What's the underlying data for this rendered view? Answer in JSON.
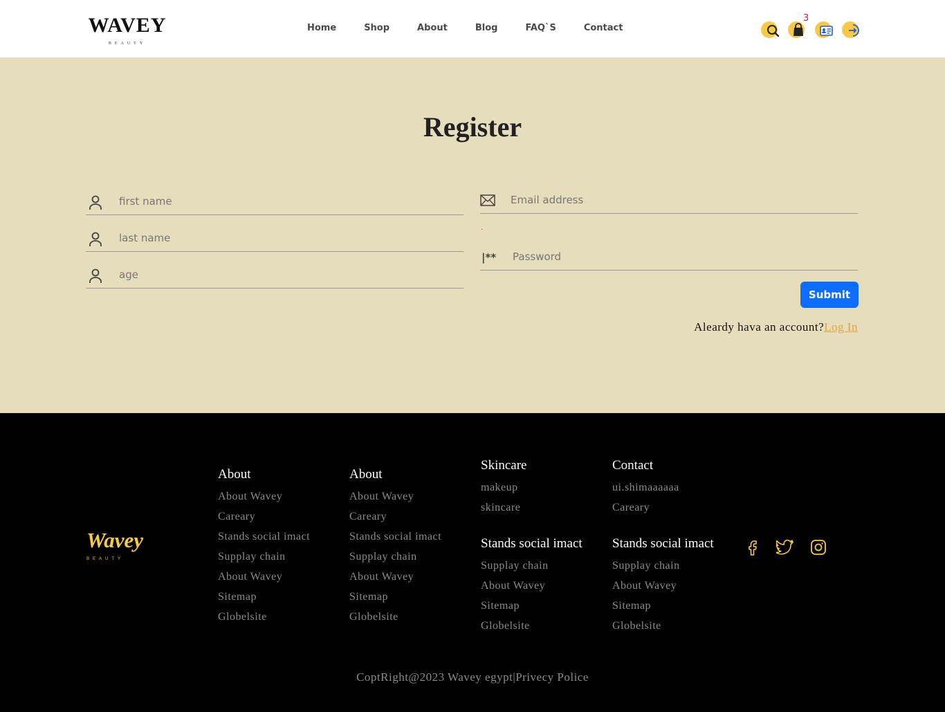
{
  "header": {
    "logo_main": "WAVEY",
    "logo_sub": "BEAUTY",
    "nav": [
      "Home",
      "Shop",
      "About",
      "Blog",
      "FAQ`S",
      "Contact"
    ],
    "cart_count": "3",
    "icons": [
      "search-icon",
      "cart-icon",
      "profile-card-icon",
      "login-icon"
    ],
    "icon_accent": "#f6c949"
  },
  "register": {
    "title": "Register",
    "first_name_placeholder": "first name",
    "last_name_placeholder": "last name",
    "age_placeholder": "age",
    "email_placeholder": "Email address",
    "email_error": ".",
    "password_mark": "|**",
    "password_placeholder": "Password",
    "submit_label": "Submit",
    "already_text": "Aleardy hava an account?",
    "login_link": "Log In",
    "background": "#e5ddbb",
    "submit_color": "#0d6efd"
  },
  "footer": {
    "logo_main": "Wavey",
    "logo_sub": "BEAUTY",
    "col1": {
      "title": "About",
      "links": [
        "About Wavey",
        "Careary",
        "Stands social imact",
        "Supplay chain",
        "About Wavey",
        "Sitemap",
        "Globelsite"
      ]
    },
    "col2": {
      "title": "About",
      "links": [
        "About Wavey",
        "Careary",
        "Stands social imact",
        "Supplay chain",
        "About Wavey",
        "Sitemap",
        "Globelsite"
      ]
    },
    "col3a": {
      "title": "Skincare",
      "links": [
        "makeup",
        "skincare"
      ]
    },
    "col3b": {
      "title": "Stands social imact",
      "links": [
        "Supplay chain",
        "About Wavey",
        "Sitemap",
        "Globelsite"
      ]
    },
    "col4a": {
      "title": "Contact",
      "links": [
        "ui.shimaaaaaa",
        "Careary"
      ]
    },
    "col4b": {
      "title": "Stands social imact",
      "links": [
        "Supplay chain",
        "About Wavey",
        "Sitemap",
        "Globelsite"
      ]
    },
    "social": [
      "facebook-icon",
      "twitter-icon",
      "instagram-icon"
    ],
    "copyright": "CoptRight@2023 Wavey egypt|Privecy Police"
  }
}
